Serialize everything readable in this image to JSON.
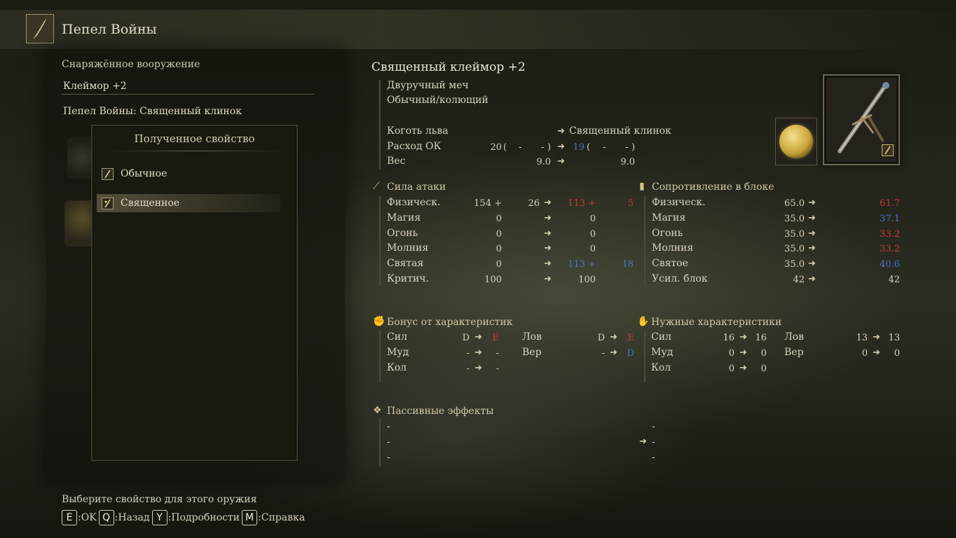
{
  "header": {
    "title": "Пепел Войны",
    "icon": "ash-of-war-icon"
  },
  "left": {
    "equipped_label": "Снаряжённое вооружение",
    "weapon_name": "Клеймор +2",
    "aow_line": "Пепел Войны: Священный клинок",
    "affinity_title": "Полученное свойство",
    "affinities": [
      {
        "label": "Обычное",
        "selected": false
      },
      {
        "label": "Священное",
        "selected": true
      }
    ]
  },
  "footer": {
    "hint": "Выберите свойство для этого оружия",
    "keys": [
      {
        "key": "E",
        "label": ":OK"
      },
      {
        "key": "Q",
        "label": ":Назад"
      },
      {
        "key": "Y",
        "label": ":Подробности"
      },
      {
        "key": "M",
        "label": ":Справка"
      }
    ]
  },
  "item": {
    "name": "Священный клеймор +2",
    "type": "Двуручный меч",
    "damage_type": "Обычный/колющий",
    "skill_from": "Коготь льва",
    "skill_to": "Священный клинок",
    "fp_label": "Расход ОК",
    "fp_from": "20",
    "fp_to": "19",
    "paren_open": "(",
    "paren_close": ")",
    "dash": "-",
    "weight_label": "Вес",
    "weight_from": "9.0",
    "weight_to": "9.0"
  },
  "attack": {
    "title": "Сила атаки",
    "rows": [
      {
        "label": "Физическ.",
        "base": "154 +",
        "add": "26",
        "new_base": "113 +",
        "new_add": "5",
        "color": "red"
      },
      {
        "label": "Магия",
        "base": "0",
        "add": "",
        "new_base": "0",
        "new_add": "",
        "color": ""
      },
      {
        "label": "Огонь",
        "base": "0",
        "add": "",
        "new_base": "0",
        "new_add": "",
        "color": ""
      },
      {
        "label": "Молния",
        "base": "0",
        "add": "",
        "new_base": "0",
        "new_add": "",
        "color": ""
      },
      {
        "label": "Святая",
        "base": "0",
        "add": "",
        "new_base": "113 +",
        "new_add": "18",
        "color": "blue"
      },
      {
        "label": "Критич.",
        "base": "100",
        "add": "",
        "new_base": "100",
        "new_add": "",
        "color": ""
      }
    ]
  },
  "guard": {
    "title": "Сопротивление в блоке",
    "rows": [
      {
        "label": "Физическ.",
        "from": "65.0",
        "to": "61.7",
        "color": "red"
      },
      {
        "label": "Магия",
        "from": "35.0",
        "to": "37.1",
        "color": "blue"
      },
      {
        "label": "Огонь",
        "from": "35.0",
        "to": "33.2",
        "color": "red"
      },
      {
        "label": "Молния",
        "from": "35.0",
        "to": "33.2",
        "color": "red"
      },
      {
        "label": "Святое",
        "from": "35.0",
        "to": "40.6",
        "color": "blue"
      },
      {
        "label": "Усил. блок",
        "from": "42",
        "to": "42",
        "color": ""
      }
    ]
  },
  "scaling": {
    "title": "Бонус от характеристик",
    "left": [
      {
        "label": "Сил",
        "from": "D",
        "to": "E",
        "color": "red"
      },
      {
        "label": "Муд",
        "from": "-",
        "to": "-",
        "color": ""
      },
      {
        "label": "Кол",
        "from": "-",
        "to": "-",
        "color": ""
      }
    ],
    "right": [
      {
        "label": "Лов",
        "from": "D",
        "to": "E",
        "color": "red"
      },
      {
        "label": "Вер",
        "from": "-",
        "to": "D",
        "color": "blue"
      }
    ]
  },
  "requirements": {
    "title": "Нужные характеристики",
    "left": [
      {
        "label": "Сил",
        "from": "16",
        "to": "16"
      },
      {
        "label": "Муд",
        "from": "0",
        "to": "0"
      },
      {
        "label": "Кол",
        "from": "0",
        "to": "0"
      }
    ],
    "right": [
      {
        "label": "Лов",
        "from": "13",
        "to": "13"
      },
      {
        "label": "Вер",
        "from": "0",
        "to": "0"
      }
    ]
  },
  "passive": {
    "title": "Пассивные эффекты",
    "left": [
      "-",
      "-",
      "-"
    ],
    "right": [
      "-",
      "-",
      "-"
    ]
  },
  "arrow": "➜"
}
